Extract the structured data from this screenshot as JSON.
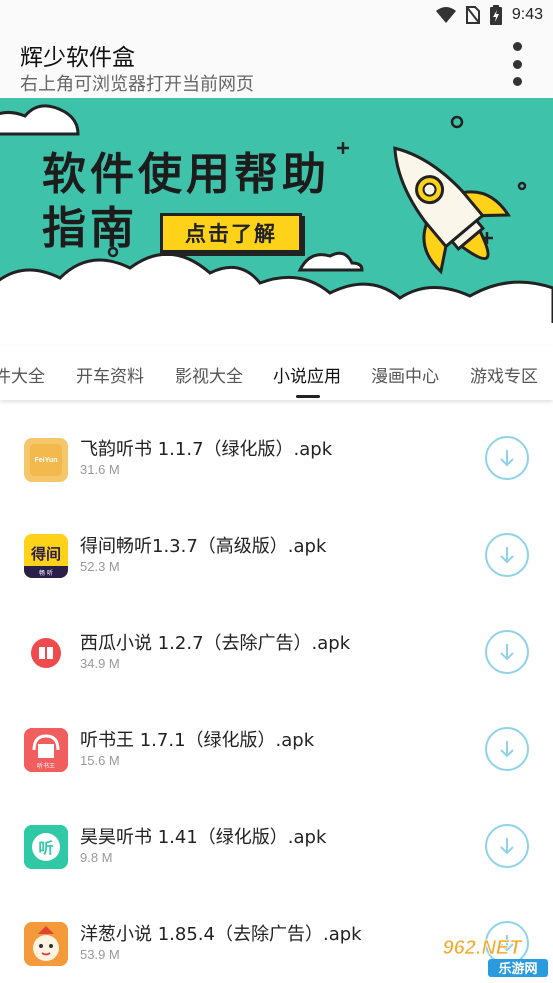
{
  "status_bar": {
    "time": "9:43",
    "icons": [
      "wifi-icon",
      "no-sim-icon",
      "battery-charging-icon"
    ]
  },
  "app_bar": {
    "title": "辉少软件盒",
    "subtitle": "右上角可浏览器打开当前网页",
    "menu_icon": "more-vert-icon"
  },
  "banner": {
    "title_line1": "软件使用帮助",
    "title_line2": "指南",
    "button_label": "点击了解",
    "background_color": "#3fc2aa",
    "button_color": "#ffd21a"
  },
  "tabs": {
    "items": [
      {
        "label": "件大全"
      },
      {
        "label": "开车资料"
      },
      {
        "label": "影视大全"
      },
      {
        "label": "小说应用"
      },
      {
        "label": "漫画中心"
      },
      {
        "label": "游戏专区"
      }
    ],
    "active_index": 3
  },
  "apps": [
    {
      "name": "飞韵听书 1.1.7（绿化版）.apk",
      "size": "31.6 M",
      "icon": "feiyun-app-icon",
      "icon_text": "FeiYun"
    },
    {
      "name": "得间畅听1.3.7（高级版）.apk",
      "size": "52.3 M",
      "icon": "dejian-app-icon",
      "icon_text": "得间",
      "icon_subtext": "畅 听"
    },
    {
      "name": "西瓜小说 1.2.7（去除广告）.apk",
      "size": "34.9 M",
      "icon": "xigua-book-icon"
    },
    {
      "name": "听书王 1.7.1（绿化版）.apk",
      "size": "15.6 M",
      "icon": "tingshuwang-app-icon",
      "icon_text": "听书王"
    },
    {
      "name": "昊昊听书 1.41（绿化版）.apk",
      "size": "9.8 M",
      "icon": "haohao-app-icon",
      "icon_text": "听"
    },
    {
      "name": "洋葱小说 1.85.4（去除广告）.apk",
      "size": "53.9 M",
      "icon": "yangcong-app-icon"
    }
  ],
  "download_icon": "download-arrow-icon",
  "accent_color": "#8fd2ea",
  "watermark": {
    "text_top": "962.NET",
    "text_bottom": "乐游网"
  }
}
